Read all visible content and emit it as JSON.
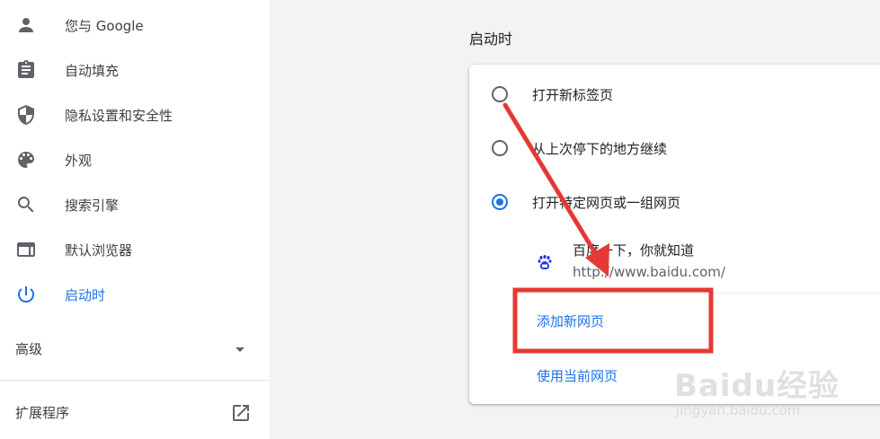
{
  "sidebar": {
    "items": [
      {
        "label": "您与 Google",
        "icon": "person-icon",
        "active": false
      },
      {
        "label": "自动填充",
        "icon": "clipboard-icon",
        "active": false
      },
      {
        "label": "隐私设置和安全性",
        "icon": "shield-icon",
        "active": false
      },
      {
        "label": "外观",
        "icon": "palette-icon",
        "active": false
      },
      {
        "label": "搜索引擎",
        "icon": "search-icon",
        "active": false
      },
      {
        "label": "默认浏览器",
        "icon": "browser-window-icon",
        "active": false
      },
      {
        "label": "启动时",
        "icon": "power-icon",
        "active": true
      }
    ],
    "advanced_label": "高级",
    "extensions_label": "扩展程序"
  },
  "startup": {
    "section_title": "启动时",
    "options": [
      {
        "label": "打开新标签页",
        "checked": false
      },
      {
        "label": "从上次停下的地方继续",
        "checked": false
      },
      {
        "label": "打开特定网页或一组网页",
        "checked": true
      }
    ],
    "site": {
      "title": "百度一下，你就知道",
      "url": "http://www.baidu.com/",
      "icon": "baidu-paw-icon"
    },
    "add_page_label": "添加新网页",
    "use_current_label": "使用当前网页"
  },
  "watermark": {
    "text": "Baidu经验",
    "sub": "jingyan.baidu.com"
  },
  "colors": {
    "accent": "#1a73e8",
    "annotation": "#e53935",
    "background": "#f1f3f4"
  }
}
